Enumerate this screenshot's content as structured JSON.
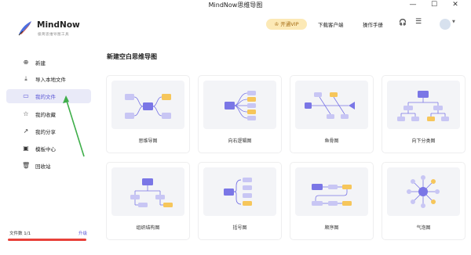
{
  "window": {
    "title": "MindNow思维导图",
    "controls": {
      "minimize": "—",
      "maximize": "☐",
      "close": "✕"
    }
  },
  "sidebar": {
    "app_name": "MindNow",
    "tagline": "极简思维导图工具",
    "items": [
      {
        "label": "新建",
        "icon": "plus-circle-icon",
        "glyph": "⊕",
        "active": false
      },
      {
        "label": "导入本地文件",
        "icon": "import-icon",
        "glyph": "⤓",
        "active": false
      },
      {
        "label": "我的文件",
        "icon": "folder-icon",
        "glyph": "▭",
        "active": true
      },
      {
        "label": "我的收藏",
        "icon": "star-icon",
        "glyph": "☆",
        "active": false
      },
      {
        "label": "我的分享",
        "icon": "share-icon",
        "glyph": "↗",
        "active": false
      },
      {
        "label": "模板中心",
        "icon": "template-icon",
        "glyph": "▣",
        "active": false
      },
      {
        "label": "回收站",
        "icon": "trash-icon",
        "glyph": "🗑",
        "active": false
      }
    ],
    "file_count": "文件数 1/1",
    "upgrade": "升级"
  },
  "topbar": {
    "vip_button": "开通VIP",
    "vip_glyph": "♔",
    "download_client": "下载客户端",
    "manual": "操作手册",
    "headset_glyph": "🎧",
    "menu_glyph": "☰",
    "avatar_caret": "▼"
  },
  "main": {
    "section_title": "新建空白思维导图",
    "templates": [
      {
        "label": "思维导图",
        "icon": "mindmap-diagram-icon"
      },
      {
        "label": "向右逻辑图",
        "icon": "right-logic-diagram-icon"
      },
      {
        "label": "鱼骨图",
        "icon": "fishbone-diagram-icon"
      },
      {
        "label": "向下分类图",
        "icon": "down-tree-diagram-icon"
      },
      {
        "label": "组织结构图",
        "icon": "org-chart-icon"
      },
      {
        "label": "括号图",
        "icon": "bracket-diagram-icon"
      },
      {
        "label": "顺序图",
        "icon": "sequence-diagram-icon"
      },
      {
        "label": "气泡图",
        "icon": "bubble-diagram-icon"
      }
    ]
  },
  "colors": {
    "accent": "#5b57d6",
    "node_main": "#7a76e6",
    "node_child": "#c8c6f4",
    "node_highlight": "#f6c65b",
    "annotation_red": "#e8413a",
    "annotation_green": "#3fae4a",
    "vip_bg": "#fce9b6"
  }
}
